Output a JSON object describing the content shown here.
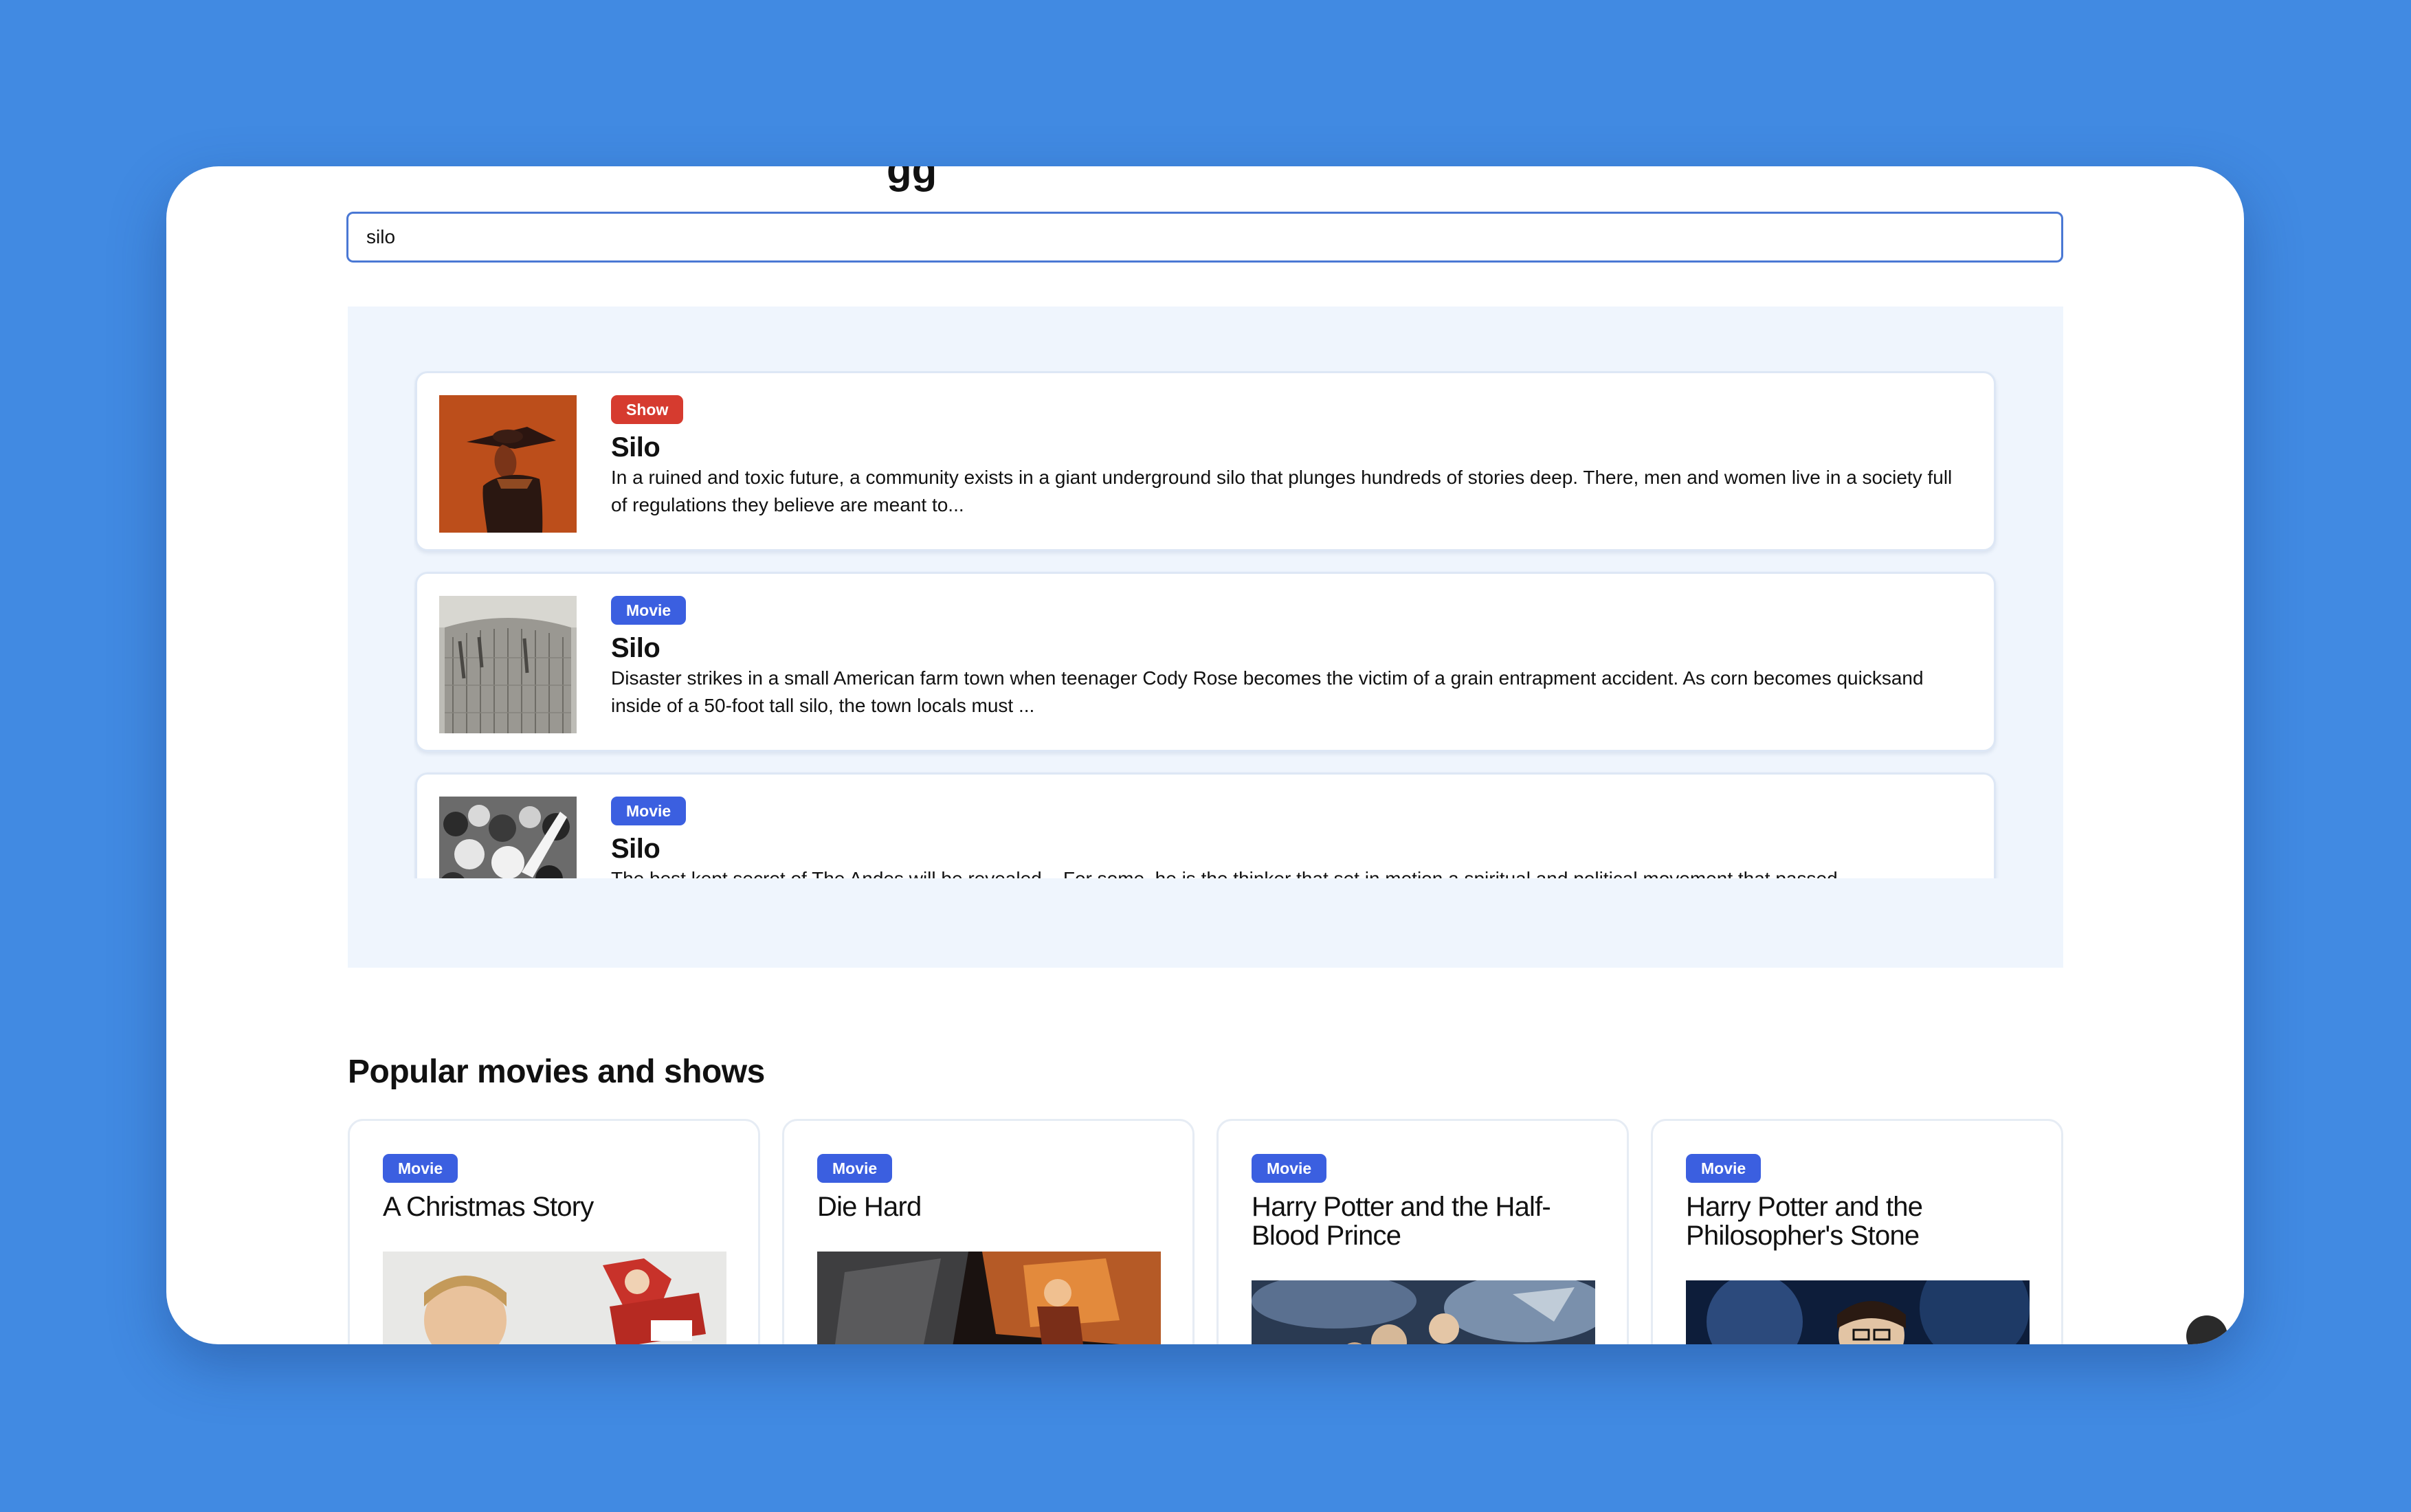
{
  "search": {
    "value": "silo",
    "placeholder": ""
  },
  "results": [
    {
      "type": "Show",
      "title": "Silo",
      "description": "In a ruined and toxic future, a community exists in a giant underground silo that plunges hundreds of stories deep. There, men and women live in a society full of regulations they believe are meant to..."
    },
    {
      "type": "Movie",
      "title": "Silo",
      "description": "Disaster strikes in a small American farm town when teenager Cody Rose becomes the victim of a grain entrapment accident. As corn becomes quicksand inside of a 50-foot tall silo, the town locals must ..."
    },
    {
      "type": "Movie",
      "title": "Silo",
      "description": "The best kept secret of The Andes will be revealed... For some, he is the thinker that set in motion a spiritual and political movement that passed"
    }
  ],
  "popular": {
    "heading": "Popular movies and shows",
    "items": [
      {
        "type": "Movie",
        "title": "A Christmas Story"
      },
      {
        "type": "Movie",
        "title": "Die Hard"
      },
      {
        "type": "Movie",
        "title": "Harry Potter and the Half-Blood Prince"
      },
      {
        "type": "Movie",
        "title": "Harry Potter and the Philosopher's Stone"
      }
    ]
  },
  "colors": {
    "background": "#418ae2",
    "show_badge": "#d63b2f",
    "movie_badge": "#3b5fe0",
    "results_panel": "#eff5fd",
    "input_border": "#4a78d4"
  },
  "icons": [
    "corner-bubble-icon"
  ]
}
